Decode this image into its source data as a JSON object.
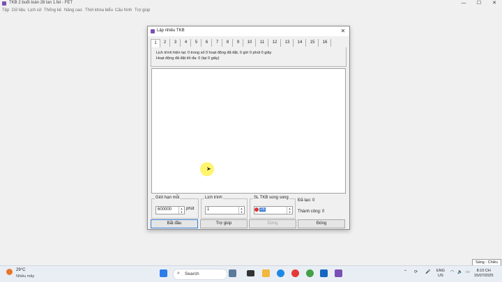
{
  "app": {
    "title": "TKB 2 buổi toàn 28 lan 1.fet - FET",
    "menu": [
      "Tệp",
      "Dữ liệu",
      "Lịch sử",
      "Thống kê",
      "Nâng cao",
      "Thời khóa biểu",
      "Cấu hình",
      "Trợ giúp"
    ]
  },
  "dialog": {
    "title": "Lập nhiều TKB",
    "close_glyph": "✕",
    "tabs": [
      "1",
      "2",
      "3",
      "4",
      "5",
      "6",
      "7",
      "8",
      "9",
      "10",
      "11",
      "12",
      "13",
      "14",
      "15",
      "16"
    ],
    "info_line1": "Lịch trình hiện tại: 0 trong số 0 hoạt động đã đặt, 0 giờ 0 phút 0 giây",
    "info_line2": "Hoạt động đã đặt tối đa: 0 (tại 0 giây)",
    "limit_group": {
      "label": "Giới hạn mỗi",
      "value": "600000",
      "unit": "phút"
    },
    "schedule_group": {
      "label": "Lịch trình",
      "value": "1"
    },
    "parallel_group": {
      "label": "SL TKB song song",
      "value": "16"
    },
    "stats": {
      "tried": "Đã tạo: 0",
      "success": "Thành công: 0"
    },
    "buttons": {
      "start": "Bắt đầu",
      "help": "Trợ giúp",
      "stop": "Dừng",
      "close": "Đóng"
    }
  },
  "lang_popup": "Sáng - Chiều",
  "taskbar": {
    "weather_temp": "29°C",
    "weather_desc": "Nhiều mây",
    "search_placeholder": "Search",
    "lang_top": "ENG",
    "lang_bottom": "US",
    "time": "8:10 CH",
    "date": "15/07/2025"
  }
}
